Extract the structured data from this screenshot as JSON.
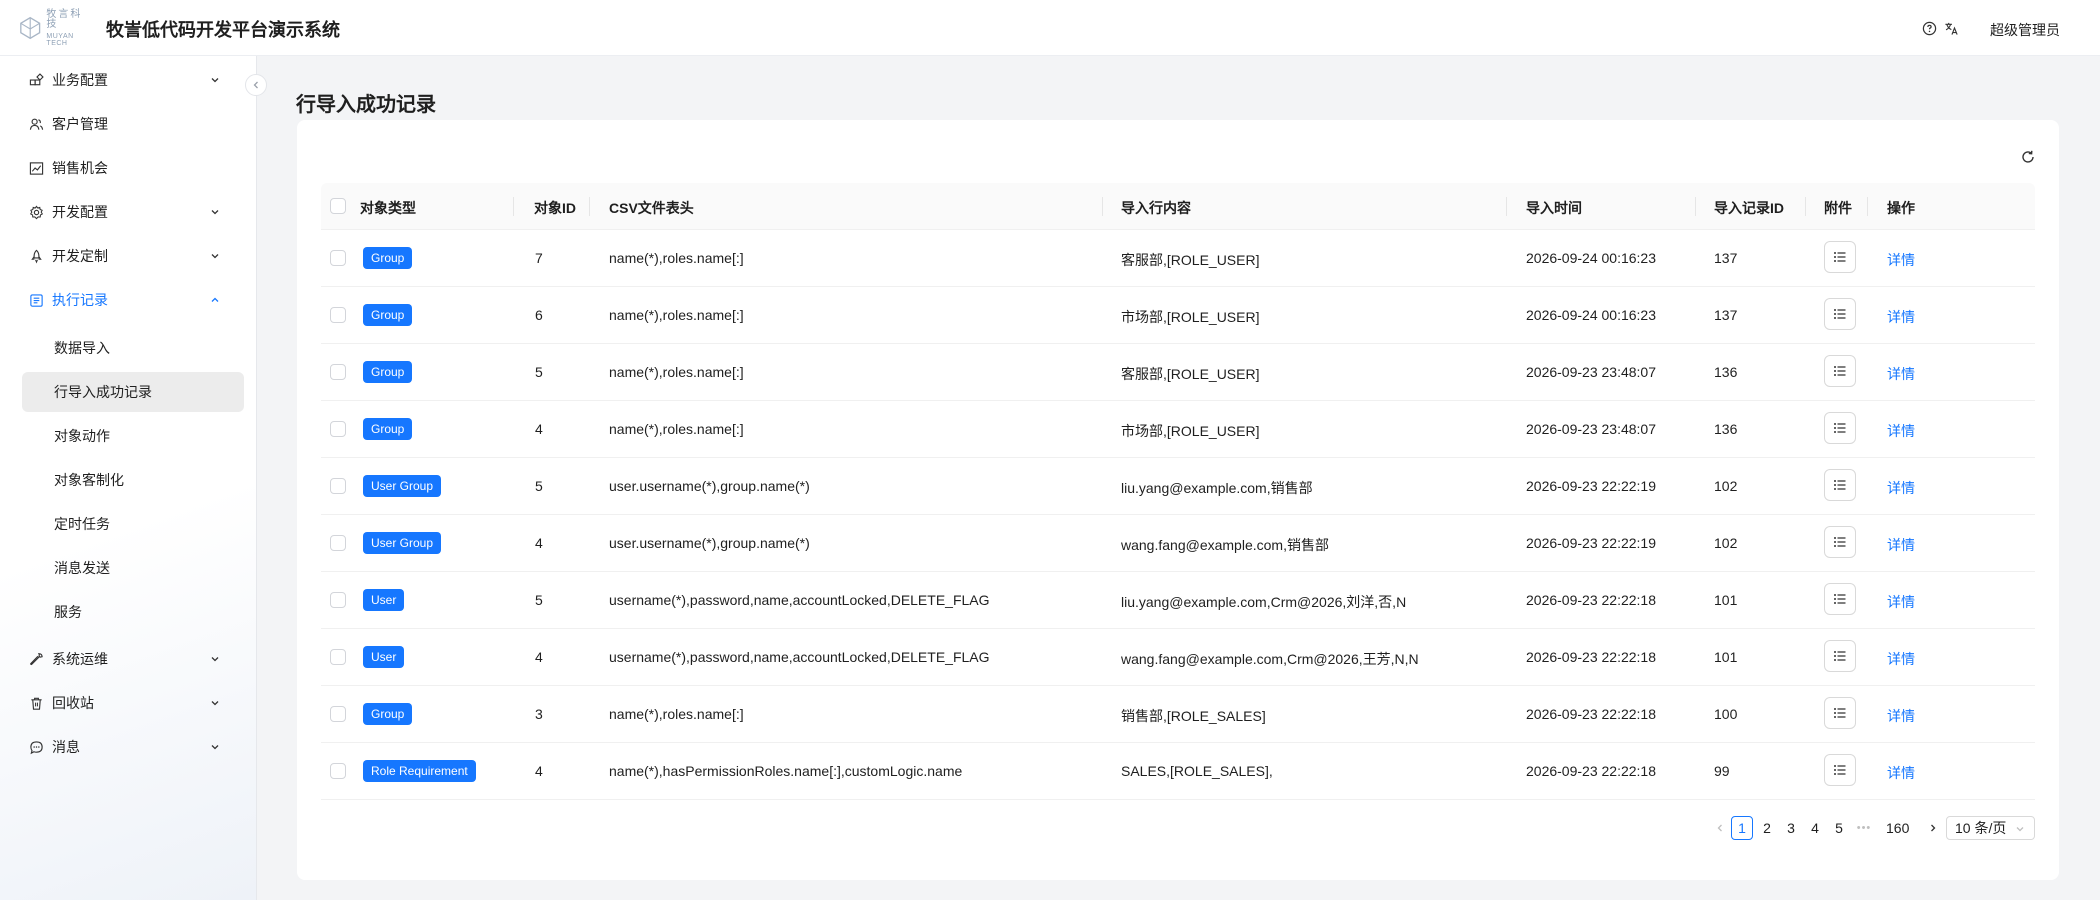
{
  "header": {
    "logo_cn": "牧言科技",
    "logo_en": "MUYAN TECH",
    "title": "牧訔低代码开发平台演示系统",
    "user": "超级管理员",
    "icons": [
      "help-icon",
      "translate-icon"
    ]
  },
  "sidebar": {
    "items": [
      {
        "label": "业务配置",
        "icon": "apps-icon",
        "expandable": true
      },
      {
        "label": "客户管理",
        "icon": "users-icon",
        "expandable": false
      },
      {
        "label": "销售机会",
        "icon": "chart-icon",
        "expandable": false
      },
      {
        "label": "开发配置",
        "icon": "gear-icon",
        "expandable": true
      },
      {
        "label": "开发定制",
        "icon": "rocket-icon",
        "expandable": true
      },
      {
        "label": "执行记录",
        "icon": "records-icon",
        "expandable": true,
        "expanded": true
      },
      {
        "label": "系统运维",
        "icon": "wrench-icon",
        "expandable": true
      },
      {
        "label": "回收站",
        "icon": "trash-icon",
        "expandable": true
      },
      {
        "label": "消息",
        "icon": "message-icon",
        "expandable": true
      }
    ],
    "sub_items": [
      {
        "label": "数据导入"
      },
      {
        "label": "行导入成功记录",
        "selected": true
      },
      {
        "label": "对象动作"
      },
      {
        "label": "对象客制化"
      },
      {
        "label": "定时任务"
      },
      {
        "label": "消息发送"
      },
      {
        "label": "服务"
      }
    ]
  },
  "main": {
    "title": "行导入成功记录",
    "columns": [
      "对象类型",
      "对象ID",
      "CSV文件表头",
      "导入行内容",
      "导入时间",
      "导入记录ID",
      "附件",
      "操作"
    ],
    "detail_label": "详情",
    "rows": [
      {
        "type": "Group",
        "id": "7",
        "header": "name(*),roles.name[:]",
        "content": "客服部,[ROLE_USER]",
        "time": "2026-09-24 00:16:23",
        "record_id": "137"
      },
      {
        "type": "Group",
        "id": "6",
        "header": "name(*),roles.name[:]",
        "content": "市场部,[ROLE_USER]",
        "time": "2026-09-24 00:16:23",
        "record_id": "137"
      },
      {
        "type": "Group",
        "id": "5",
        "header": "name(*),roles.name[:]",
        "content": "客服部,[ROLE_USER]",
        "time": "2026-09-23 23:48:07",
        "record_id": "136"
      },
      {
        "type": "Group",
        "id": "4",
        "header": "name(*),roles.name[:]",
        "content": "市场部,[ROLE_USER]",
        "time": "2026-09-23 23:48:07",
        "record_id": "136"
      },
      {
        "type": "User Group",
        "id": "5",
        "header": "user.username(*),group.name(*)",
        "content": "liu.yang@example.com,销售部",
        "time": "2026-09-23 22:22:19",
        "record_id": "102"
      },
      {
        "type": "User Group",
        "id": "4",
        "header": "user.username(*),group.name(*)",
        "content": "wang.fang@example.com,销售部",
        "time": "2026-09-23 22:22:19",
        "record_id": "102"
      },
      {
        "type": "User",
        "id": "5",
        "header": "username(*),password,name,accountLocked,DELETE_FLAG",
        "content": "liu.yang@example.com,Crm@2026,刘洋,否,N",
        "time": "2026-09-23 22:22:18",
        "record_id": "101"
      },
      {
        "type": "User",
        "id": "4",
        "header": "username(*),password,name,accountLocked,DELETE_FLAG",
        "content": "wang.fang@example.com,Crm@2026,王芳,N,N",
        "time": "2026-09-23 22:22:18",
        "record_id": "101"
      },
      {
        "type": "Group",
        "id": "3",
        "header": "name(*),roles.name[:]",
        "content": "销售部,[ROLE_SALES]",
        "time": "2026-09-23 22:22:18",
        "record_id": "100"
      },
      {
        "type": "Role Requirement",
        "id": "4",
        "header": "name(*),hasPermissionRoles.name[:],customLogic.name",
        "content": "SALES,[ROLE_SALES],",
        "time": "2026-09-23 22:22:18",
        "record_id": "99"
      }
    ]
  },
  "pagination": {
    "pages": [
      "1",
      "2",
      "3",
      "4",
      "5"
    ],
    "current": "1",
    "ellipsis": "•••",
    "last": "160",
    "page_size": "10 条/页"
  },
  "colors": {
    "accent": "#1677ff",
    "tag_bg": "#1677ff"
  }
}
